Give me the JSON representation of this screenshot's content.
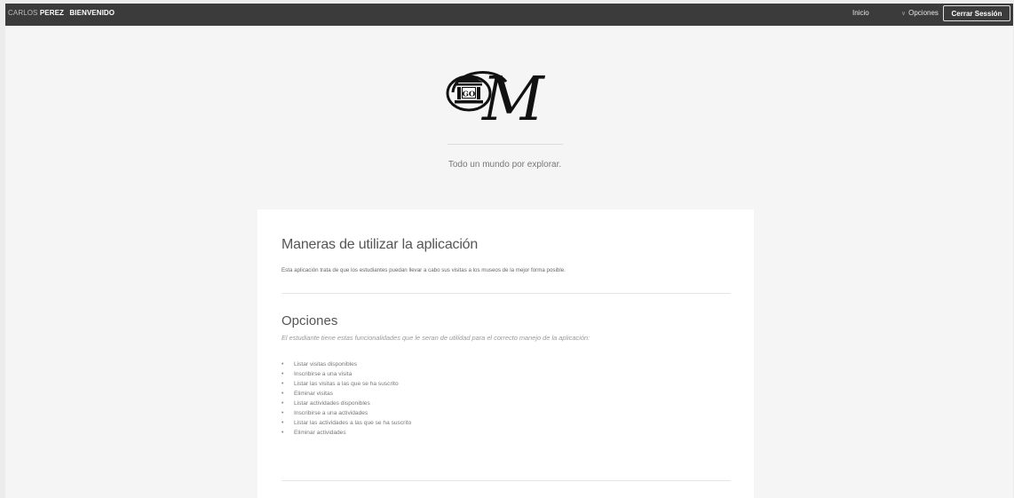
{
  "header": {
    "first_name": "CARLOS",
    "last_name": "PEREZ",
    "welcome": "BIENVENIDO",
    "nav_inicio": "Inicio",
    "nav_opciones": "Opciones",
    "logout": "Cerrar Sessión"
  },
  "hero": {
    "logo_text": "GO",
    "logo_letter": "M",
    "tagline": "Todo un mundo por explorar."
  },
  "card": {
    "ways_title": "Maneras de utilizar la aplicación",
    "ways_text": "Esta aplicación trata de que los estudiantes puedan llevar a cabo sus visitas a los museos de la mejor forma posible.",
    "options_title": "Opciones",
    "options_subtitle": "El estudiante tiene estas funcionalidades que le seran de utilidad para el correcto manejo de la aplicación:",
    "options": [
      "Listar visitas disponibles",
      "Inscribirse a una visita",
      "Listar las visitas a las que se ha suscrito",
      "Eliminar visitas",
      "Listar actividades disponibles",
      "Inscribirse a una actividades",
      "Listar las actividades a las que se ha suscrito",
      "Eliminar actividades"
    ]
  },
  "icons": {
    "chevron": "chevron-down-icon",
    "bullet": "bullet-icon",
    "logo": "museum-logo-icon"
  },
  "colors": {
    "topbar": "#3b3b3b",
    "background": "#f5f5f5",
    "card": "#ffffff"
  }
}
